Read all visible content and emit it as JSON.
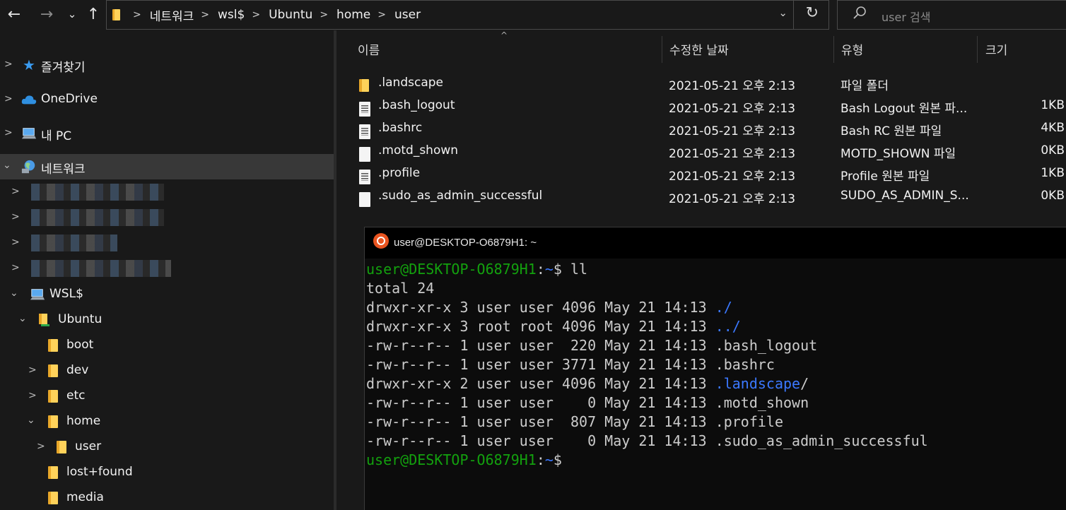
{
  "address_bar": {
    "crumbs": [
      "네트워크",
      "wsl$",
      "Ubuntu",
      "home",
      "user"
    ],
    "search_placeholder": "user 검색"
  },
  "nav": {
    "quick_access": "즐겨찾기",
    "onedrive": "OneDrive",
    "this_pc": "내 PC",
    "network": "네트워크",
    "wsl": "WSL$",
    "ubuntu": "Ubuntu",
    "folders": [
      "boot",
      "dev",
      "etc",
      "home",
      "user",
      "lost+found",
      "media"
    ]
  },
  "file_list": {
    "columns": [
      "이름",
      "수정한 날짜",
      "유형",
      "크기"
    ],
    "rows": [
      {
        "name": ".landscape",
        "date": "2021-05-21 오후 2:13",
        "type": "파일 폴더",
        "size": "",
        "icon": "folder-icon"
      },
      {
        "name": ".bash_logout",
        "date": "2021-05-21 오후 2:13",
        "type": "Bash Logout 원본 파...",
        "size": "1KB",
        "icon": "text-file-icon"
      },
      {
        "name": ".bashrc",
        "date": "2021-05-21 오후 2:13",
        "type": "Bash RC 원본 파일",
        "size": "4KB",
        "icon": "text-file-icon"
      },
      {
        "name": ".motd_shown",
        "date": "2021-05-21 오후 2:13",
        "type": "MOTD_SHOWN 파일",
        "size": "0KB",
        "icon": "blank-file-icon"
      },
      {
        "name": ".profile",
        "date": "2021-05-21 오후 2:13",
        "type": "Profile 원본 파일",
        "size": "1KB",
        "icon": "text-file-icon"
      },
      {
        "name": ".sudo_as_admin_successful",
        "date": "2021-05-21 오후 2:13",
        "type": "SUDO_AS_ADMIN_S...",
        "size": "0KB",
        "icon": "blank-file-icon"
      }
    ]
  },
  "terminal": {
    "title": "user@DESKTOP-O6879H1: ~",
    "prompt_user": "user@DESKTOP-O6879H1",
    "prompt_sep": ":",
    "prompt_path": "~",
    "prompt_end": "$ ",
    "command": "ll",
    "total": "total 24",
    "listing": [
      {
        "meta": "drwxr-xr-x 3 user user 4096 May 21 14:13 ",
        "name": "./",
        "dir": true
      },
      {
        "meta": "drwxr-xr-x 3 root root 4096 May 21 14:13 ",
        "name": "../",
        "dir": true
      },
      {
        "meta": "-rw-r--r-- 1 user user  220 May 21 14:13 ",
        "name": ".bash_logout",
        "dir": false
      },
      {
        "meta": "-rw-r--r-- 1 user user 3771 May 21 14:13 ",
        "name": ".bashrc",
        "dir": false
      },
      {
        "meta": "drwxr-xr-x 2 user user 4096 May 21 14:13 ",
        "name": ".landscape",
        "dir": true,
        "suffix": "/"
      },
      {
        "meta": "-rw-r--r-- 1 user user    0 May 21 14:13 ",
        "name": ".motd_shown",
        "dir": false
      },
      {
        "meta": "-rw-r--r-- 1 user user  807 May 21 14:13 ",
        "name": ".profile",
        "dir": false
      },
      {
        "meta": "-rw-r--r-- 1 user user    0 May 21 14:13 ",
        "name": ".sudo_as_admin_successful",
        "dir": false
      }
    ]
  },
  "colors": {
    "terminal_green": "#13a10e",
    "terminal_blue": "#3b78ff",
    "folder_yellow": "#ffd25a",
    "ubuntu_orange": "#e95420"
  }
}
